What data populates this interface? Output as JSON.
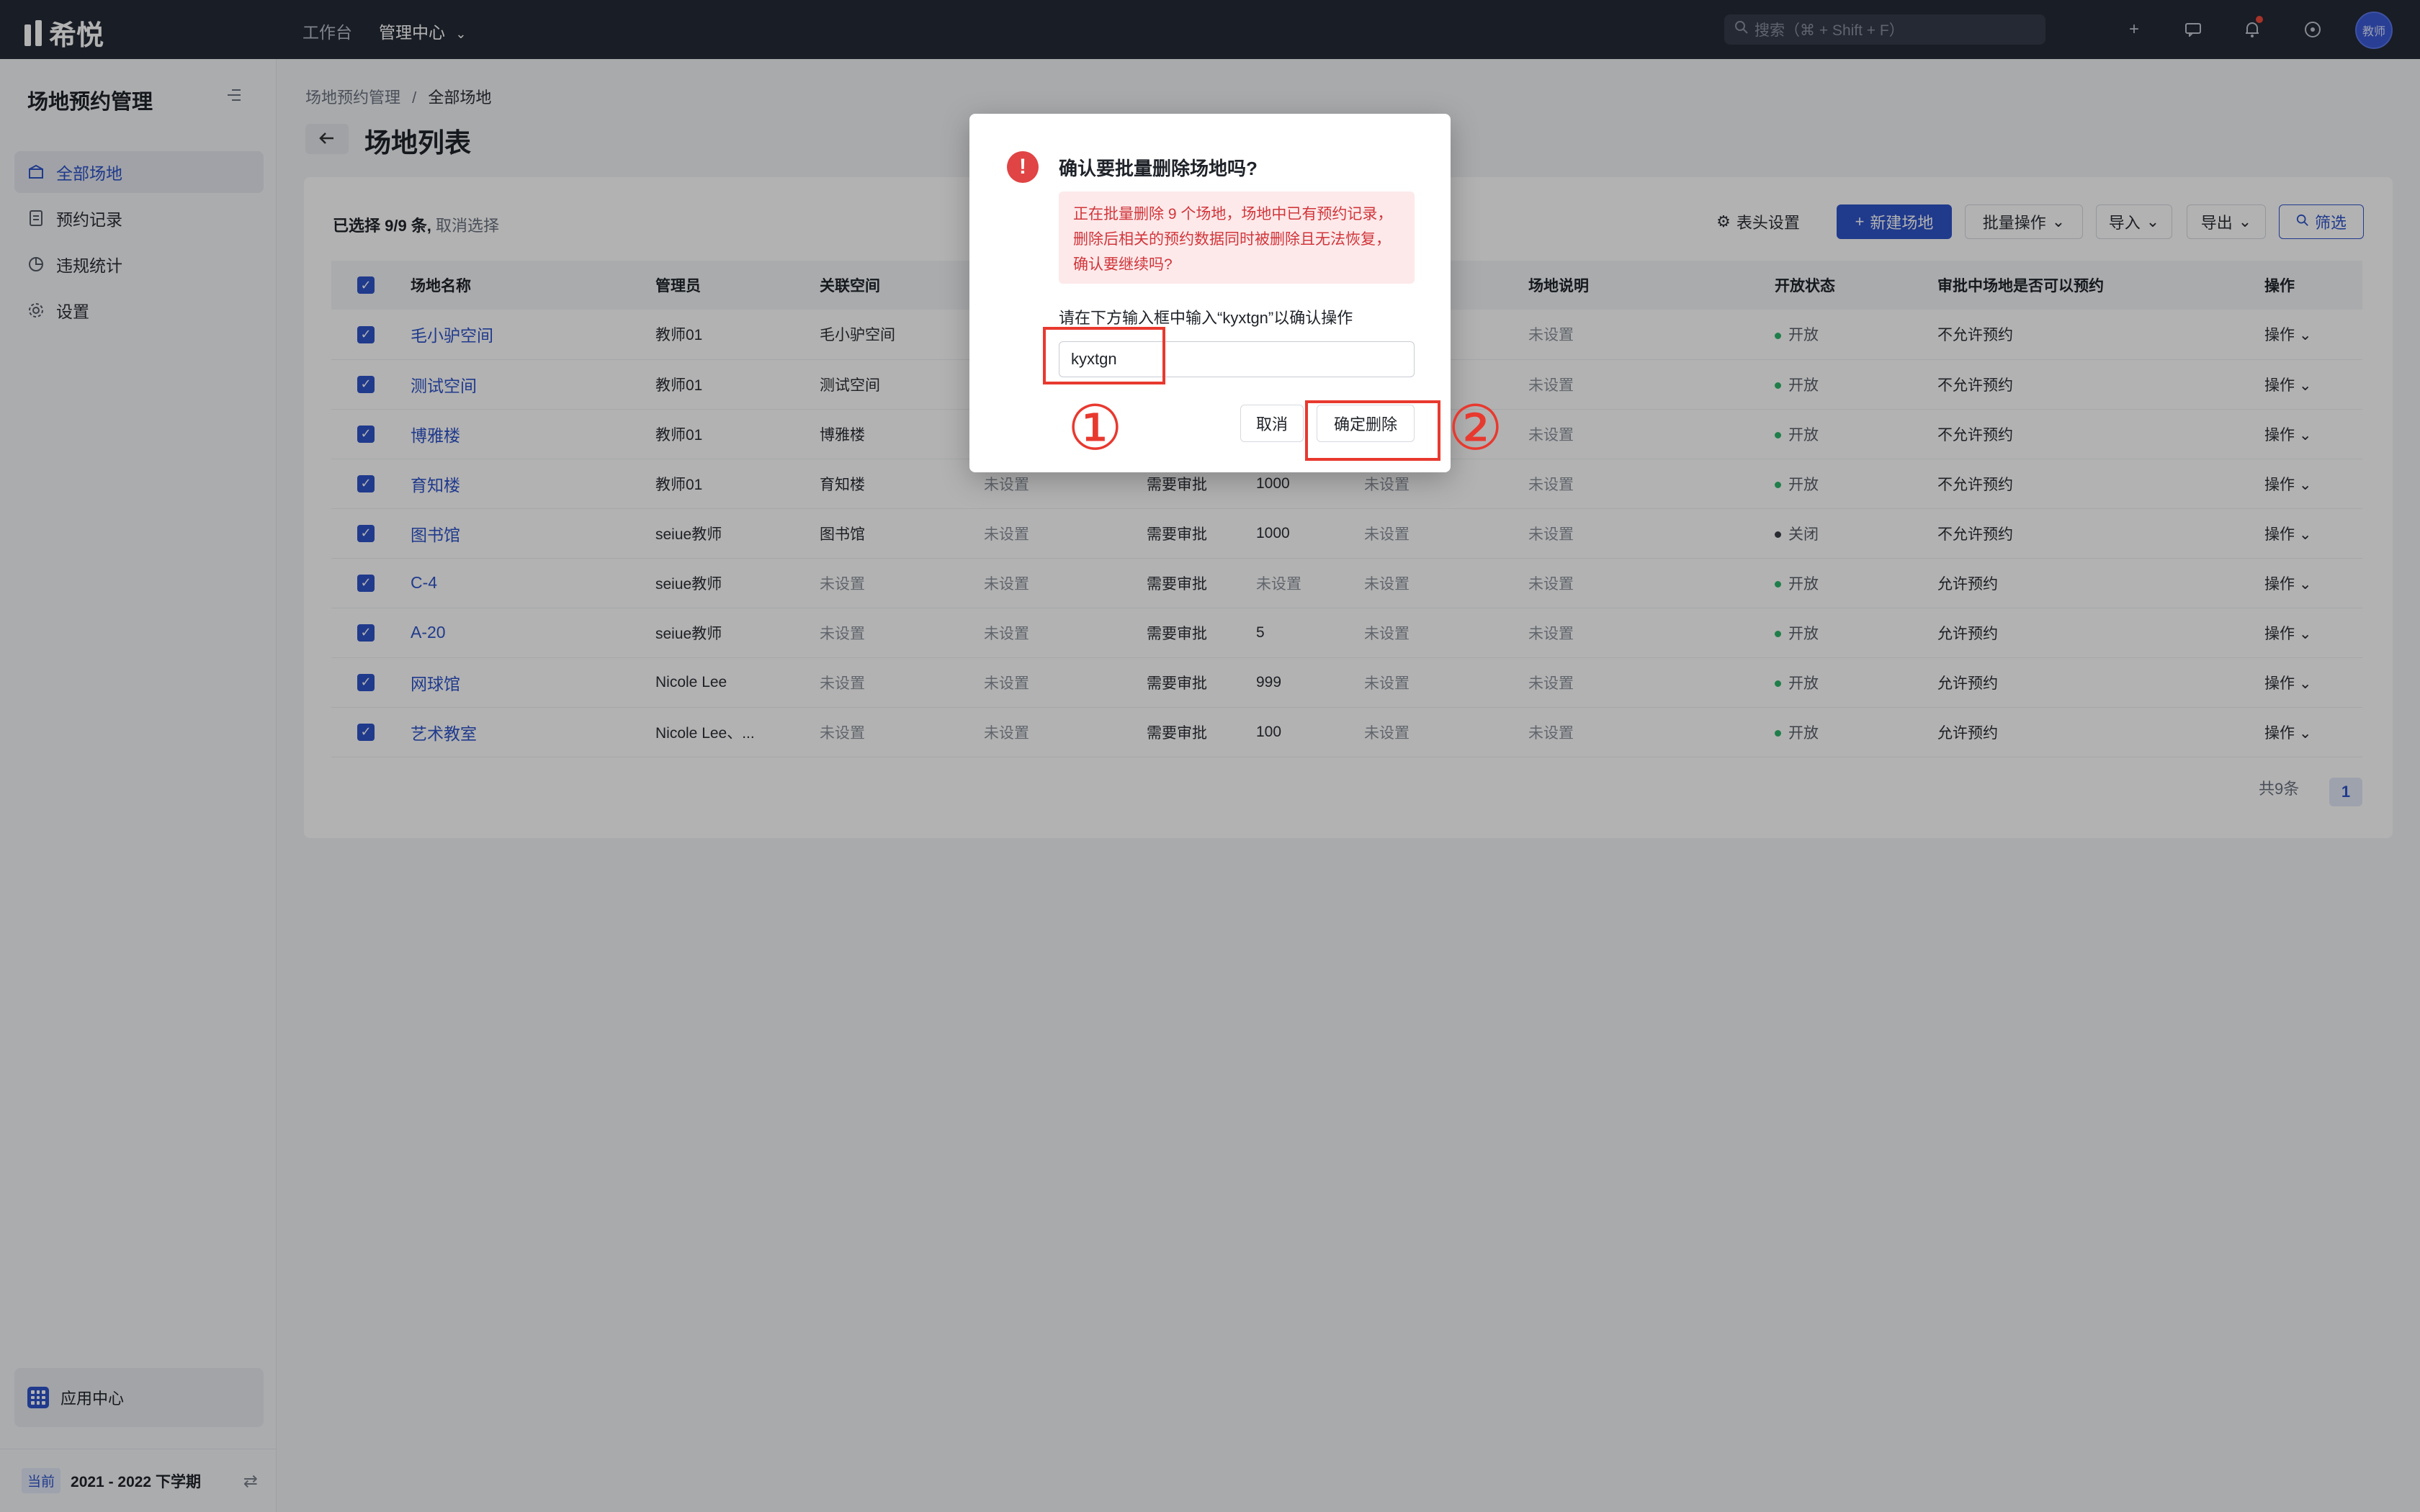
{
  "topbar": {
    "logo_text": "希悦",
    "nav": [
      "工作台",
      "管理中心"
    ],
    "search_placeholder": "搜索（⌘ + Shift + F）",
    "avatar_text": "教师"
  },
  "sidebar": {
    "title": "场地预约管理",
    "items": [
      {
        "label": "全部场地",
        "icon": "venue-icon",
        "active": true
      },
      {
        "label": "预约记录",
        "icon": "record-icon",
        "active": false
      },
      {
        "label": "违规统计",
        "icon": "pie-chart-icon",
        "active": false
      },
      {
        "label": "设置",
        "icon": "gear-icon",
        "active": false
      }
    ],
    "app_center": "应用中心",
    "term_tag": "当前",
    "term": "2021 - 2022 下学期"
  },
  "main": {
    "breadcrumb": [
      "场地预约管理",
      "全部场地"
    ],
    "breadcrumb_sep": "/",
    "title": "场地列表",
    "selection": "已选择 9/9 条,",
    "cancel_selection": "取消选择",
    "toolbar": {
      "column_settings": "表头设置",
      "new_venue": "新建场地",
      "batch": "批量操作",
      "import": "导入",
      "export": "导出",
      "filter": "筛选"
    },
    "table": {
      "headers": [
        "场地名称",
        "管理员",
        "关联空间",
        "",
        "",
        "",
        "",
        "场地说明",
        "开放状态",
        "审批中场地是否可以预约",
        "操作"
      ],
      "rows": [
        {
          "name": "毛小驴空间",
          "admin": "教师01",
          "space": "毛小驴空间",
          "c4": "",
          "c5": "",
          "c6": "",
          "c7": "",
          "desc": "未设置",
          "status": "开放",
          "open": true,
          "allow": "不允许预约",
          "op": "操作"
        },
        {
          "name": "测试空间",
          "admin": "教师01",
          "space": "测试空间",
          "c4": "",
          "c5": "",
          "c6": "",
          "c7": "",
          "desc": "未设置",
          "status": "开放",
          "open": true,
          "allow": "不允许预约",
          "op": "操作"
        },
        {
          "name": "博雅楼",
          "admin": "教师01",
          "space": "博雅楼",
          "c4": "",
          "c5": "",
          "c6": "",
          "c7": "",
          "desc": "未设置",
          "status": "开放",
          "open": true,
          "allow": "不允许预约",
          "op": "操作"
        },
        {
          "name": "育知楼",
          "admin": "教师01",
          "space": "育知楼",
          "c4": "未设置",
          "c5": "需要审批",
          "c6": "1000",
          "c7": "未设置",
          "desc": "未设置",
          "status": "开放",
          "open": true,
          "allow": "不允许预约",
          "op": "操作"
        },
        {
          "name": "图书馆",
          "admin": "seiue教师",
          "space": "图书馆",
          "c4": "未设置",
          "c5": "需要审批",
          "c6": "1000",
          "c7": "未设置",
          "desc": "未设置",
          "status": "关闭",
          "open": false,
          "allow": "不允许预约",
          "op": "操作"
        },
        {
          "name": "C-4",
          "admin": "seiue教师",
          "space": "未设置",
          "c4": "未设置",
          "c5": "需要审批",
          "c6": "未设置",
          "c7": "未设置",
          "desc": "未设置",
          "status": "开放",
          "open": true,
          "allow": "允许预约",
          "op": "操作"
        },
        {
          "name": "A-20",
          "admin": "seiue教师",
          "space": "未设置",
          "c4": "未设置",
          "c5": "需要审批",
          "c6": "5",
          "c7": "未设置",
          "desc": "未设置",
          "status": "开放",
          "open": true,
          "allow": "允许预约",
          "op": "操作"
        },
        {
          "name": "网球馆",
          "admin": "Nicole Lee",
          "space": "未设置",
          "c4": "未设置",
          "c5": "需要审批",
          "c6": "999",
          "c7": "未设置",
          "desc": "未设置",
          "status": "开放",
          "open": true,
          "allow": "允许预约",
          "op": "操作"
        },
        {
          "name": "艺术教室",
          "admin": "Nicole Lee、...",
          "space": "未设置",
          "c4": "未设置",
          "c5": "需要审批",
          "c6": "100",
          "c7": "未设置",
          "desc": "未设置",
          "status": "开放",
          "open": true,
          "allow": "允许预约",
          "op": "操作"
        }
      ]
    },
    "total": "共9条",
    "page": "1"
  },
  "dialog": {
    "title": "确认要批量删除场地吗?",
    "alert": "正在批量删除 9 个场地，场地中已有预约记录，删除后相关的预约数据同时被删除且无法恢复，确认要继续吗?",
    "hint": "请在下方输入框中输入“kyxtgn”以确认操作",
    "input_value": "kyxtgn",
    "cancel": "取消",
    "confirm": "确定删除"
  },
  "annotations": {
    "step1": "①",
    "step2": "②",
    "color": "#e8392f"
  },
  "colors": {
    "accent": "#2f54c9",
    "topbar": "#252a36",
    "danger": "#e04444",
    "open": "#2fb56a"
  }
}
